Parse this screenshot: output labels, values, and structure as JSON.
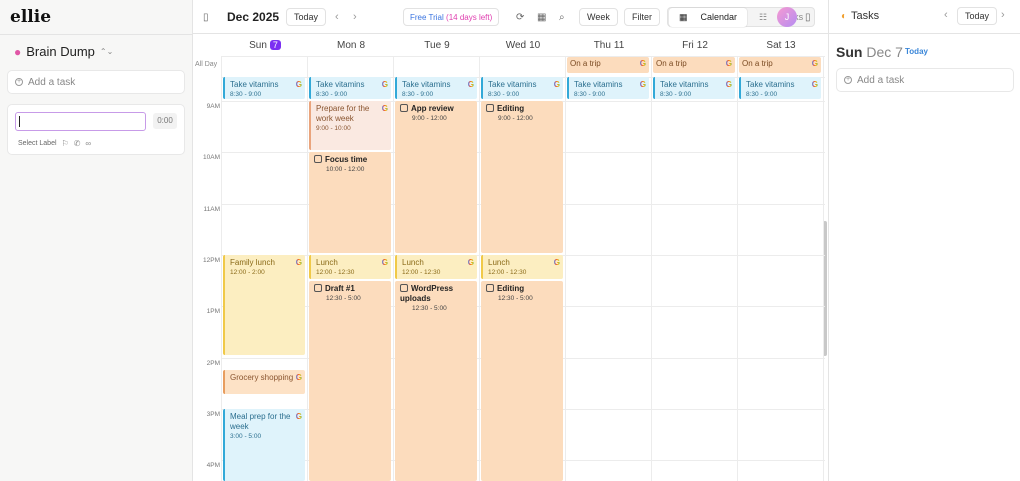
{
  "app": {
    "logo": "ellie"
  },
  "brain_dump": {
    "title": "Brain Dump",
    "add_task": "Add a task",
    "new_task_duration": "0:00",
    "select_label": "Select Label"
  },
  "toolbar": {
    "month": "Dec 2025",
    "today": "Today",
    "trial_a": "Free Trial",
    "trial_b": "(14 days left)",
    "week": "Week",
    "filter": "Filter",
    "calendar": "Calendar",
    "tasks": "Tasks",
    "avatar_initial": "J"
  },
  "calendar": {
    "all_day_label": "All Day",
    "days": [
      {
        "dow": "Sun",
        "num": "7",
        "today": true
      },
      {
        "dow": "Mon",
        "num": "8"
      },
      {
        "dow": "Tue",
        "num": "9"
      },
      {
        "dow": "Wed",
        "num": "10"
      },
      {
        "dow": "Thu",
        "num": "11"
      },
      {
        "dow": "Fri",
        "num": "12"
      },
      {
        "dow": "Sat",
        "num": "13"
      }
    ],
    "hours": [
      "9AM",
      "10AM",
      "11AM",
      "12PM",
      "1PM",
      "2PM",
      "3PM",
      "4PM"
    ],
    "events": [
      {
        "day": 4,
        "kind": "trip",
        "title": "On a trip",
        "allday": true
      },
      {
        "day": 5,
        "kind": "trip",
        "title": "On a trip",
        "allday": true
      },
      {
        "day": 6,
        "kind": "trip",
        "title": "On a trip",
        "allday": true
      },
      {
        "day": 0,
        "kind": "blue",
        "title": "Take vitamins",
        "time": "8:30 - 9:00",
        "start": 8.5,
        "end": 9
      },
      {
        "day": 1,
        "kind": "blue",
        "title": "Take vitamins",
        "time": "8:30 - 9:00",
        "start": 8.5,
        "end": 9
      },
      {
        "day": 2,
        "kind": "blue",
        "title": "Take vitamins",
        "time": "8:30 - 9:00",
        "start": 8.5,
        "end": 9
      },
      {
        "day": 3,
        "kind": "blue",
        "title": "Take vitamins",
        "time": "8:30 - 9:00",
        "start": 8.5,
        "end": 9
      },
      {
        "day": 4,
        "kind": "blue",
        "title": "Take vitamins",
        "time": "8:30 - 9:00",
        "start": 8.5,
        "end": 9
      },
      {
        "day": 5,
        "kind": "blue",
        "title": "Take vitamins",
        "time": "8:30 - 9:00",
        "start": 8.5,
        "end": 9
      },
      {
        "day": 6,
        "kind": "blue",
        "title": "Take vitamins",
        "time": "8:30 - 9:00",
        "start": 8.5,
        "end": 9
      },
      {
        "day": 1,
        "kind": "pink",
        "title": "Prepare for the work week",
        "time": "9:00 - 10:00",
        "start": 9,
        "end": 10
      },
      {
        "day": 1,
        "kind": "task",
        "title": "Focus time",
        "time": "10:00 - 12:00",
        "start": 10,
        "end": 12
      },
      {
        "day": 2,
        "kind": "task",
        "title": "App review",
        "time": "9:00 - 12:00",
        "start": 9,
        "end": 12
      },
      {
        "day": 3,
        "kind": "task",
        "title": "Editing",
        "time": "9:00 - 12:00",
        "start": 9,
        "end": 12
      },
      {
        "day": 0,
        "kind": "yellow",
        "title": "Family lunch",
        "time": "12:00 - 2:00",
        "start": 12,
        "end": 14
      },
      {
        "day": 1,
        "kind": "yellow",
        "title": "Lunch",
        "time": "12:00 - 12:30",
        "start": 12,
        "end": 12.5
      },
      {
        "day": 2,
        "kind": "yellow",
        "title": "Lunch",
        "time": "12:00 - 12:30",
        "start": 12,
        "end": 12.5
      },
      {
        "day": 3,
        "kind": "yellow",
        "title": "Lunch",
        "time": "12:00 - 12:30",
        "start": 12,
        "end": 12.5
      },
      {
        "day": 1,
        "kind": "task",
        "title": "Draft #1",
        "time": "12:30 - 5:00",
        "start": 12.5,
        "end": 17
      },
      {
        "day": 2,
        "kind": "task",
        "title": "WordPress uploads",
        "time": "12:30 - 5:00",
        "start": 12.5,
        "end": 17
      },
      {
        "day": 3,
        "kind": "task",
        "title": "Editing",
        "time": "12:30 - 5:00",
        "start": 12.5,
        "end": 17
      },
      {
        "day": 0,
        "kind": "peach2",
        "title": "Grocery shopping",
        "start": 14.25,
        "end": 14.75
      },
      {
        "day": 0,
        "kind": "blue",
        "title": "Meal prep for the week",
        "time": "3:00 - 5:00",
        "start": 15,
        "end": 17
      }
    ]
  },
  "tasks_panel": {
    "title": "Tasks",
    "today_btn": "Today",
    "date_dow": "Sun",
    "date_md": "Dec 7",
    "today_tag": "Today",
    "add_task": "Add a task"
  }
}
